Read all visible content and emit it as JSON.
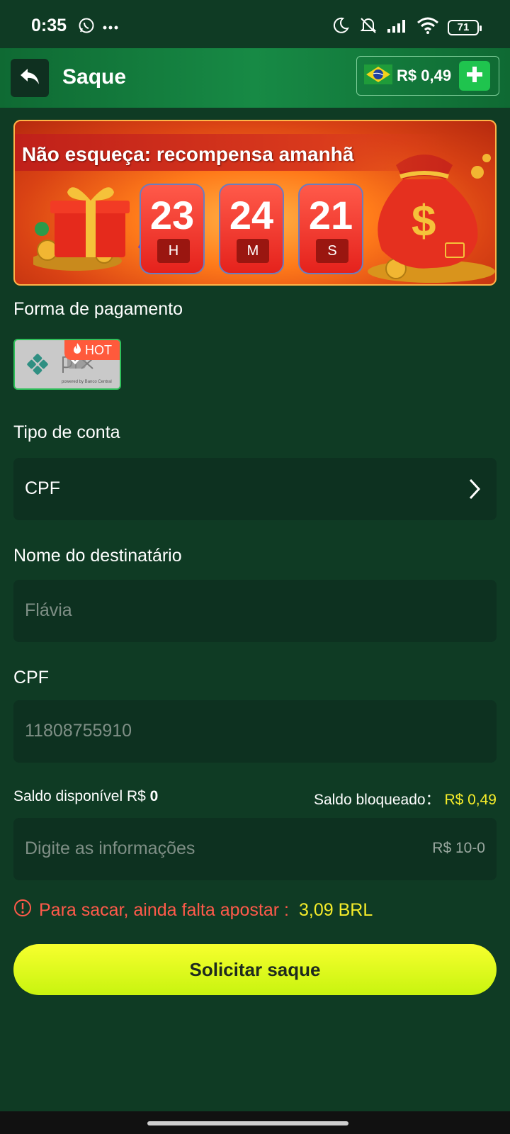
{
  "status_bar": {
    "time": "0:35",
    "battery": "71",
    "icons": [
      "whatsapp-icon",
      "more-dots-icon",
      "moon-icon",
      "muted-bell-icon",
      "signal-icon",
      "wifi-icon",
      "battery-icon"
    ]
  },
  "header": {
    "back_icon": "back-arrow-icon",
    "title": "Saque",
    "flag": "brazil-flag-icon",
    "balance": "R$ 0,49",
    "add_icon": "plus-icon"
  },
  "banner": {
    "title": "Não esqueça: recompensa amanhã",
    "timer": [
      {
        "value": "23",
        "unit": "H"
      },
      {
        "value": "24",
        "unit": "M"
      },
      {
        "value": "21",
        "unit": "S"
      }
    ]
  },
  "payment": {
    "label": "Forma de pagamento",
    "method_name": "pix",
    "method_tagline": "powered by Banco Central",
    "hot_badge": "HOT"
  },
  "account_type": {
    "label": "Tipo de conta",
    "value": "CPF"
  },
  "recipient": {
    "label": "Nome do destinatário",
    "value": "Flávia"
  },
  "cpf": {
    "label": "CPF",
    "value": "11808755910"
  },
  "balances": {
    "available_label": "Saldo disponível R$",
    "available_value": "0",
    "blocked_label": "Saldo bloqueado：",
    "blocked_value": "R$ 0,49"
  },
  "amount_input": {
    "placeholder": "Digite as informações",
    "range": "R$ 10-0"
  },
  "warning": {
    "text": "Para sacar, ainda falta apostar :",
    "amount": "3,09 BRL"
  },
  "submit_label": "Solicitar saque",
  "colors": {
    "background": "#0f3b24",
    "header": "#178a45",
    "field": "#0d3120",
    "accent_yellow": "#f5ec2a",
    "warning_red": "#ff5a4a",
    "button": "#dffc1e"
  }
}
